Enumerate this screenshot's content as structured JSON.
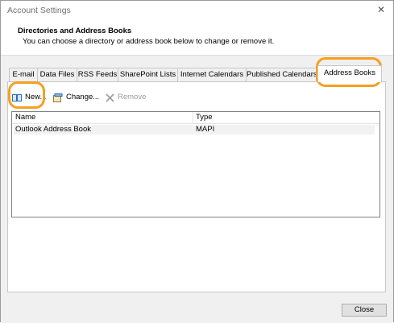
{
  "window": {
    "title": "Account Settings"
  },
  "header": {
    "heading": "Directories and Address Books",
    "subtext": "You can choose a directory or address book below to change or remove it."
  },
  "tabs": [
    {
      "label": "E-mail"
    },
    {
      "label": "Data Files"
    },
    {
      "label": "RSS Feeds"
    },
    {
      "label": "SharePoint Lists"
    },
    {
      "label": "Internet Calendars"
    },
    {
      "label": "Published Calendars"
    },
    {
      "label": "Address Books",
      "active": true
    }
  ],
  "toolbar": {
    "new_label": "New...",
    "change_label": "Change...",
    "remove_label": "Remove"
  },
  "table": {
    "columns": [
      "Name",
      "Type"
    ],
    "rows": [
      {
        "name": "Outlook Address Book",
        "type": "MAPI"
      }
    ]
  },
  "footer": {
    "close_label": "Close"
  },
  "colors": {
    "highlight": "#f5a01e",
    "panel_bg": "#f0f0f0"
  }
}
